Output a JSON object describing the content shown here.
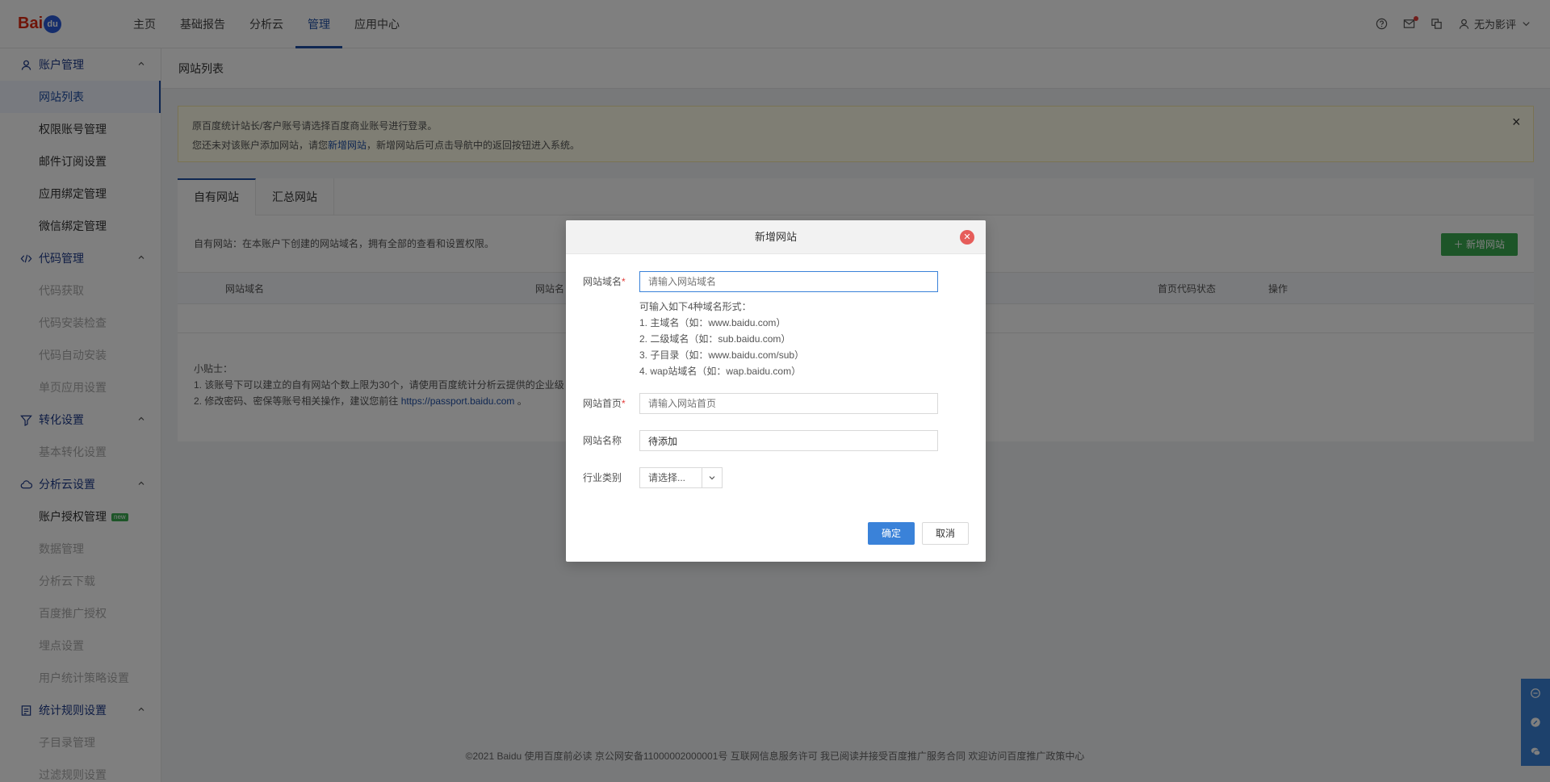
{
  "header": {
    "logo": {
      "bai": "Bai",
      "du": "du",
      "tongji": "统计"
    },
    "nav": [
      "主页",
      "基础报告",
      "分析云",
      "管理",
      "应用中心"
    ],
    "active_nav": "管理",
    "username": "无为影评"
  },
  "sidebar": {
    "groups": [
      {
        "label": "账户管理",
        "icon": "user-icon",
        "items": [
          {
            "label": "网站列表",
            "state": "active"
          },
          {
            "label": "权限账号管理",
            "state": "normal"
          },
          {
            "label": "邮件订阅设置",
            "state": "normal"
          },
          {
            "label": "应用绑定管理",
            "state": "normal"
          },
          {
            "label": "微信绑定管理",
            "state": "normal"
          }
        ]
      },
      {
        "label": "代码管理",
        "icon": "code-icon",
        "items": [
          {
            "label": "代码获取",
            "state": "disabled"
          },
          {
            "label": "代码安装检查",
            "state": "disabled"
          },
          {
            "label": "代码自动安装",
            "state": "disabled"
          },
          {
            "label": "单页应用设置",
            "state": "disabled"
          }
        ]
      },
      {
        "label": "转化设置",
        "icon": "filter-icon",
        "items": [
          {
            "label": "基本转化设置",
            "state": "disabled"
          }
        ]
      },
      {
        "label": "分析云设置",
        "icon": "cloud-icon",
        "items": [
          {
            "label": "账户授权管理",
            "state": "normal",
            "badge": "new"
          },
          {
            "label": "数据管理",
            "state": "disabled"
          },
          {
            "label": "分析云下载",
            "state": "disabled"
          },
          {
            "label": "百度推广授权",
            "state": "disabled"
          },
          {
            "label": "埋点设置",
            "state": "disabled"
          },
          {
            "label": "用户统计策略设置",
            "state": "disabled"
          }
        ]
      },
      {
        "label": "统计规则设置",
        "icon": "rules-icon",
        "items": [
          {
            "label": "子目录管理",
            "state": "disabled"
          },
          {
            "label": "过滤规则设置",
            "state": "disabled"
          }
        ]
      }
    ]
  },
  "main": {
    "page_title": "网站列表",
    "notice": {
      "line1": "原百度统计站长/客户账号请选择百度商业账号进行登录。",
      "line2_prefix": "您还未对该账户添加网站，请您",
      "line2_link": "新增网站",
      "line2_suffix": "，新增网站后可点击导航中的返回按钮进入系统。"
    },
    "tabs": [
      "自有网站",
      "汇总网站"
    ],
    "desc": "自有网站：在本账户下创建的网站域名，拥有全部的查看和设置权限。",
    "add_button": "新增网站",
    "columns": [
      "网站域名",
      "网站名",
      "首页代码状态",
      "操作"
    ],
    "tips": {
      "title": "小贴士：",
      "line1": "1. 该账号下可以建立的自有网站个数上限为30个，请使用百度统计分析云提供的企业级",
      "line2_prefix": "2. 修改密码、密保等账号相关操作，建议您前往 ",
      "line2_link": "https://passport.baidu.com",
      "line2_suffix": " 。"
    }
  },
  "footer": "©2021 Baidu 使用百度前必读 京公网安备11000002000001号 互联网信息服务许可 我已阅读并接受百度推广服务合同 欢迎访问百度推广政策中心",
  "modal": {
    "title": "新增网站",
    "domain_label": "网站域名",
    "domain_placeholder": "请输入网站域名",
    "hints": [
      "可输入如下4种域名形式：",
      "1. 主域名（如：www.baidu.com）",
      "2. 二级域名（如：sub.baidu.com）",
      "3. 子目录（如：www.baidu.com/sub）",
      "4. wap站域名（如：wap.baidu.com）"
    ],
    "homepage_label": "网站首页",
    "homepage_placeholder": "请输入网站首页",
    "name_label": "网站名称",
    "name_value": "待添加",
    "industry_label": "行业类别",
    "industry_value": "请选择...",
    "confirm": "确定",
    "cancel": "取消"
  },
  "colors": {
    "primary": "#3a82d9",
    "nav_active": "#1f4ea5",
    "green": "#3aab51",
    "close_red": "#e65d5a"
  }
}
